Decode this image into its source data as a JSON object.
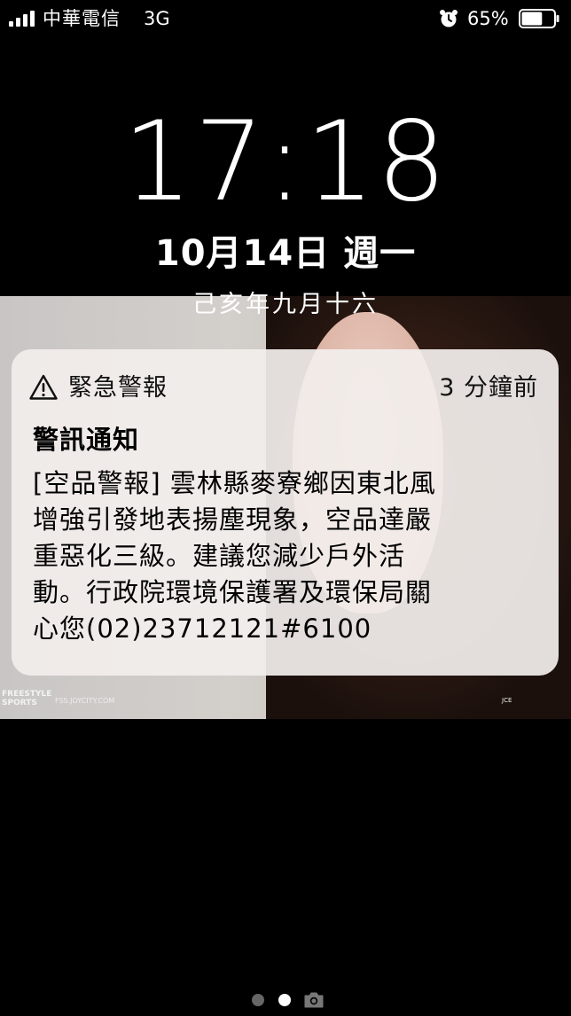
{
  "status_bar": {
    "carrier": "中華電信",
    "network": "3G",
    "battery_percent_label": "65%",
    "battery_level": 0.65,
    "signal_bars": 4,
    "icons": [
      "signal-icon",
      "alarm-icon",
      "battery-icon"
    ]
  },
  "lock_screen": {
    "time": "17:18",
    "date": "10月14日 週一",
    "lunar_date": "己亥年九月十六"
  },
  "wallpaper": {
    "logo_left": "FREESTYLE\nSPORTS",
    "logo_mid": "FSS.JOYCITY.COM",
    "logo_right": "JCE"
  },
  "notification": {
    "app_name": "緊急警報",
    "time_ago": "3 分鐘前",
    "title": "警訊通知",
    "body_lines": [
      "[空品警報] 雲林縣麥寮鄉因東北風",
      "增強引發地表揚塵現象，空品達嚴",
      "重惡化三級。建議您減少戶外活",
      "動。行政院環境保護署及環保局關",
      "心您(02)23712121#6100"
    ],
    "icon": "warning-icon"
  },
  "page_indicator": {
    "pages": 2,
    "active": 1,
    "extra_icon": "camera-icon"
  },
  "colors": {
    "background": "#000000",
    "notification_bg": "#f2eeec",
    "text_on_dark": "#ffffff",
    "text_on_card": "#000000",
    "dot_inactive": "#666666",
    "dot_active": "#ffffff"
  }
}
